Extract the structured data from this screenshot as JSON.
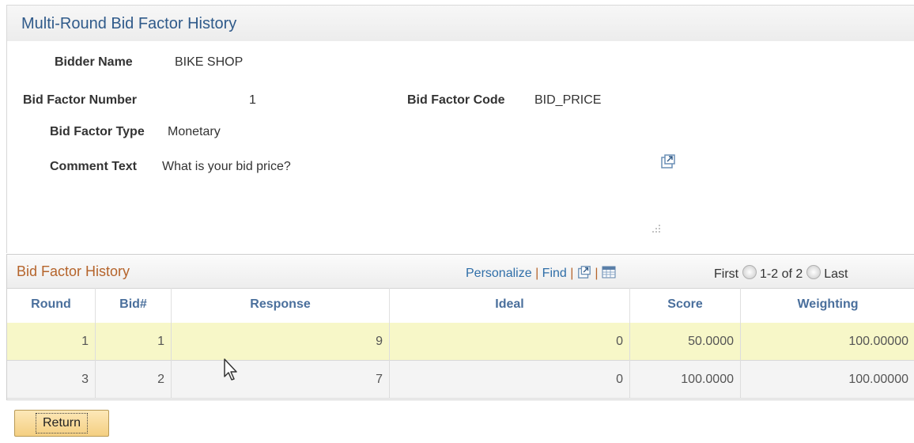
{
  "page": {
    "title": "Multi-Round Bid Factor History"
  },
  "form": {
    "bidder_name_label": "Bidder Name",
    "bidder_name_value": "BIKE SHOP",
    "bid_factor_number_label": "Bid Factor Number",
    "bid_factor_number_value": "1",
    "bid_factor_code_label": "Bid Factor Code",
    "bid_factor_code_value": "BID_PRICE",
    "bid_factor_type_label": "Bid Factor Type",
    "bid_factor_type_value": "Monetary",
    "comment_text_label": "Comment Text",
    "comment_text_value": "What is your bid price?",
    "expand_icon": "expand-window-icon",
    "resize_icon": "resize-grip-icon"
  },
  "grid": {
    "title": "Bid Factor History",
    "personalize": "Personalize",
    "find": "Find",
    "separator": "|",
    "first": "First",
    "range": "1-2 of 2",
    "last": "Last",
    "columns": [
      "Round",
      "Bid#",
      "Response",
      "Ideal",
      "Score",
      "Weighting"
    ],
    "rows": [
      {
        "round": "1",
        "bid": "1",
        "response": "9",
        "ideal": "0",
        "score": "50.0000",
        "weighting": "100.00000"
      },
      {
        "round": "3",
        "bid": "2",
        "response": "7",
        "ideal": "0",
        "score": "100.0000",
        "weighting": "100.00000"
      }
    ],
    "highlight_color": "#f7f7c8"
  },
  "actions": {
    "return_label": "Return"
  }
}
